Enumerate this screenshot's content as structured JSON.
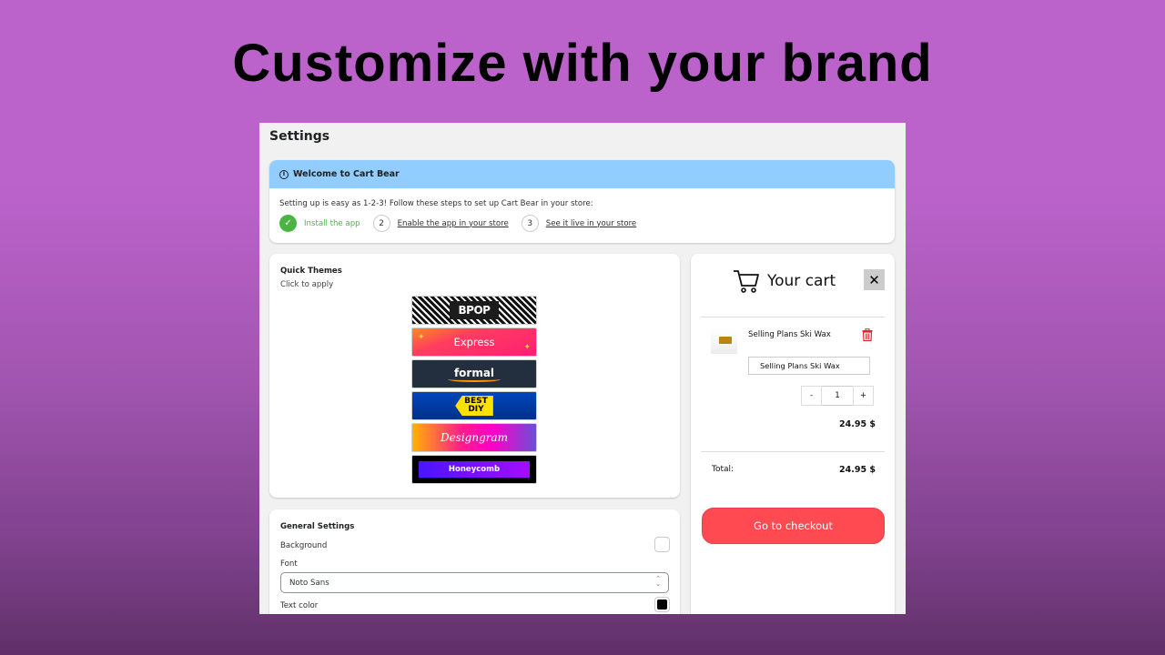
{
  "headline": "Customize with your brand",
  "app": {
    "page_title": "Settings",
    "banner": {
      "title": "Welcome to Cart Bear",
      "info_icon": "info-icon",
      "text": "Setting up is easy as 1-2-3! Follow these steps to set up Cart Bear in your store:",
      "steps": [
        {
          "number": "1",
          "label": "Install the app",
          "status": "done"
        },
        {
          "number": "2",
          "label": "Enable the app in your store",
          "status": "pending"
        },
        {
          "number": "3",
          "label": "See it live in your store",
          "status": "pending"
        }
      ]
    },
    "quick_themes": {
      "title": "Quick Themes",
      "subtitle": "Click to apply",
      "themes": [
        {
          "name": "BPOP",
          "label": "BPOP"
        },
        {
          "name": "Express",
          "label": "Express"
        },
        {
          "name": "formal",
          "label": "formal"
        },
        {
          "name": "Best DIY",
          "label_line1": "BEST",
          "label_line2": "DIY"
        },
        {
          "name": "Designgram",
          "label": "Designgram"
        },
        {
          "name": "Honeycomb",
          "label": "Honeycomb"
        }
      ]
    },
    "general_settings": {
      "title": "General Settings",
      "background_label": "Background",
      "background_color": "#ffffff",
      "font_label": "Font",
      "font_value": "Noto Sans",
      "text_color_label": "Text color",
      "text_color": "#000000"
    },
    "cart": {
      "title": "Your cart",
      "close_label": "✕",
      "item": {
        "name": "Selling Plans Ski Wax",
        "variant": "Selling Plans Ski Wax",
        "qty_minus": "-",
        "qty": "1",
        "qty_plus": "+",
        "price": "24.95  $"
      },
      "total_label": "Total:",
      "total_value": "24.95  $",
      "checkout_label": "Go to checkout"
    }
  },
  "colors": {
    "checkout": "#ff4a51",
    "banner_header": "#91cdfe",
    "success": "#4bb543",
    "delete": "#e5242b"
  }
}
